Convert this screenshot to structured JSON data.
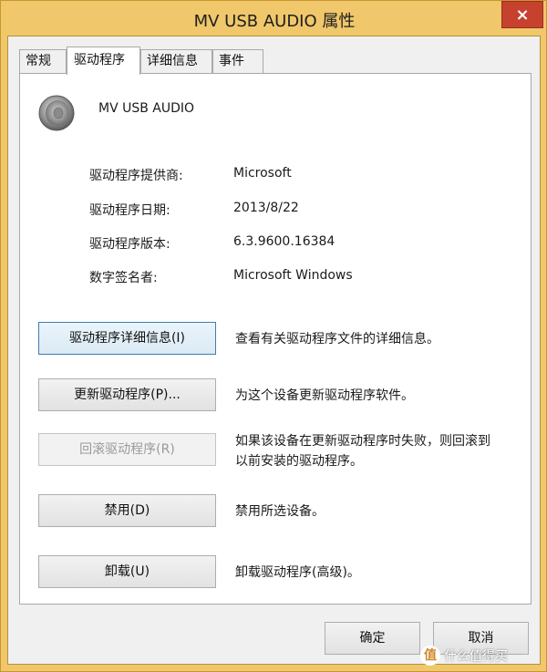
{
  "window": {
    "title": "MV USB AUDIO 属性",
    "close_glyph": "×"
  },
  "tabs": [
    {
      "label": "常规",
      "active": false
    },
    {
      "label": "驱动程序",
      "active": true
    },
    {
      "label": "详细信息",
      "active": false
    },
    {
      "label": "事件",
      "active": false
    }
  ],
  "device": {
    "icon": "speaker-icon",
    "name": "MV USB AUDIO"
  },
  "info": [
    {
      "label": "驱动程序提供商:",
      "value": "Microsoft"
    },
    {
      "label": "驱动程序日期:",
      "value": "2013/8/22"
    },
    {
      "label": "驱动程序版本:",
      "value": "6.3.9600.16384"
    },
    {
      "label": "数字签名者:",
      "value": "Microsoft Windows"
    }
  ],
  "actions": [
    {
      "button": "驱动程序详细信息(I)",
      "description": "查看有关驱动程序文件的详细信息。",
      "enabled": true,
      "focused": true
    },
    {
      "button": "更新驱动程序(P)...",
      "description": "为这个设备更新驱动程序软件。",
      "enabled": true,
      "focused": false
    },
    {
      "button": "回滚驱动程序(R)",
      "description_line1": "如果该设备在更新驱动程序时失败，则回滚到",
      "description_line2": "以前安装的驱动程序。",
      "enabled": false,
      "focused": false
    },
    {
      "button": "禁用(D)",
      "description": "禁用所选设备。",
      "enabled": true,
      "focused": false
    },
    {
      "button": "卸载(U)",
      "description": "卸载驱动程序(高级)。",
      "enabled": true,
      "focused": false
    }
  ],
  "footer": {
    "ok_label": "确定",
    "cancel_label": "取消"
  },
  "watermark": {
    "logo_text": "值",
    "text": "什么值得买"
  },
  "colors": {
    "window_frame": "#f0c76a",
    "close_button": "#c7412f",
    "focus_border": "#3c7fb1"
  }
}
